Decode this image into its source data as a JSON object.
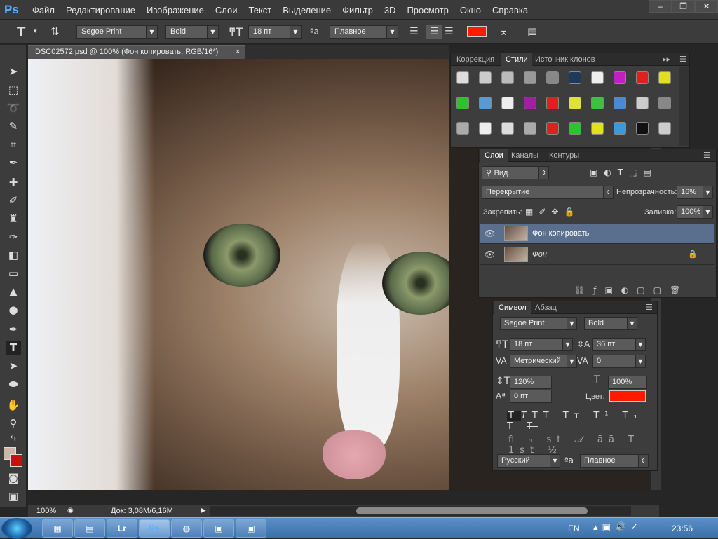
{
  "app": {
    "logo": "Ps"
  },
  "menu": [
    "Файл",
    "Редактирование",
    "Изображение",
    "Слои",
    "Текст",
    "Выделение",
    "Фильтр",
    "3D",
    "Просмотр",
    "Окно",
    "Справка"
  ],
  "options": {
    "font_family": "Segoe Print",
    "font_style": "Bold",
    "font_size": "18 пт",
    "antialias": "Плавное",
    "color": "#ff1a00"
  },
  "document": {
    "tab_title": "DSC02572.psd @ 100% (Фон копировать, RGB/16*)",
    "close": "×"
  },
  "status": {
    "zoom": "100%",
    "doc_info": "Док: 3,08M/6,16M"
  },
  "styles_panel": {
    "tabs": [
      "Коррекция",
      "Стили",
      "Источник клонов"
    ],
    "active_tab": "Стили"
  },
  "layers_panel": {
    "tabs": [
      "Слои",
      "Каналы",
      "Контуры"
    ],
    "filter": "Вид",
    "blend_mode": "Перекрытие",
    "opacity_label": "Непрозрачность:",
    "opacity": "16%",
    "lock_label": "Закрепить:",
    "fill_label": "Заливка:",
    "fill": "100%",
    "layers": [
      {
        "name": "Фон копировать",
        "selected": true
      },
      {
        "name": "Фон",
        "selected": false
      }
    ]
  },
  "character_panel": {
    "tabs": [
      "Символ",
      "Абзац"
    ],
    "font_family": "Segoe Print",
    "font_style": "Bold",
    "size": "18 пт",
    "leading": "36 пт",
    "kerning": "Метрический",
    "tracking": "0",
    "vscale": "120%",
    "hscale": "100%",
    "baseline": "0 пт",
    "color_label": "Цвет:",
    "color": "#ff1a00",
    "language": "Русский",
    "antialias": "Плавное"
  },
  "taskbar": {
    "lang": "EN",
    "time": "23:56"
  }
}
